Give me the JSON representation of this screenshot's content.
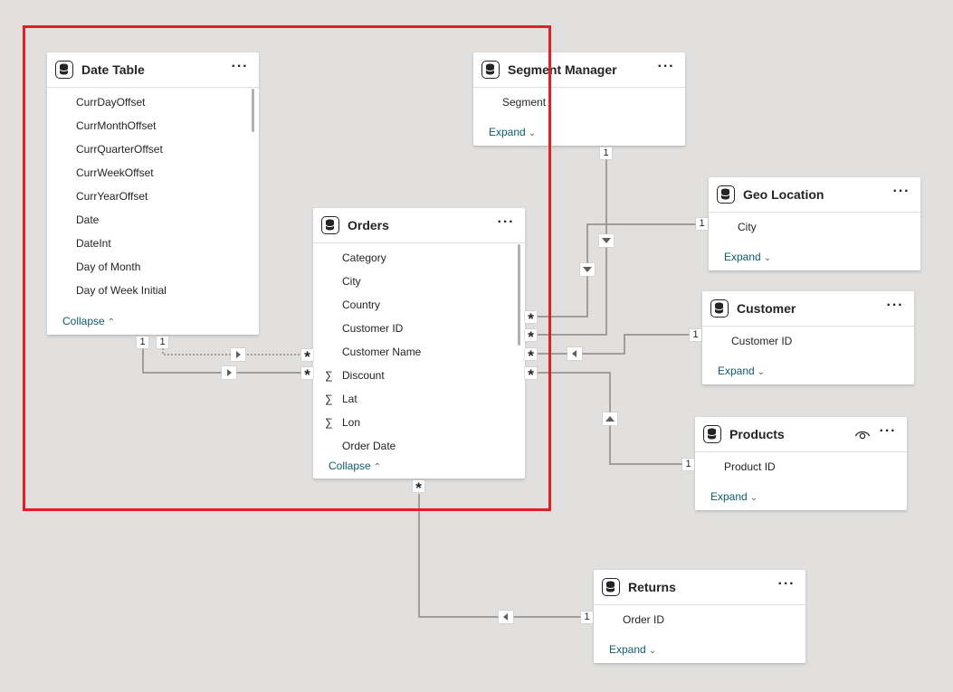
{
  "colors": {
    "canvas": "#e1e0df",
    "card": "#ffffff",
    "selection": "#e11f26",
    "line": "#8a8886",
    "toggle_text": "#0e5c6f"
  },
  "icons": {
    "table": "table-icon",
    "more": "more-options-icon",
    "eye": "eye-icon",
    "sigma": "sum-icon",
    "chevron_up": "chevron-up-icon",
    "chevron_down": "chevron-down-icon"
  },
  "cards": {
    "date_table": {
      "title": "Date Table",
      "more": "···",
      "fields": [
        "CurrDayOffset",
        "CurrMonthOffset",
        "CurrQuarterOffset",
        "CurrWeekOffset",
        "CurrYearOffset",
        "Date",
        "DateInt",
        "Day of Month",
        "Day of Week Initial"
      ],
      "toggle": "Collapse",
      "toggle_chevron": "⌃"
    },
    "segment_manager": {
      "title": "Segment Manager",
      "more": "···",
      "fields": [
        "Segment"
      ],
      "toggle": "Expand",
      "toggle_chevron": "⌄"
    },
    "geo_location": {
      "title": "Geo Location",
      "more": "···",
      "fields": [
        "City"
      ],
      "toggle": "Expand",
      "toggle_chevron": "⌄"
    },
    "orders": {
      "title": "Orders",
      "more": "···",
      "fields": [
        "Category",
        "City",
        "Country",
        "Customer ID",
        "Customer Name",
        "Discount",
        "Lat",
        "Lon",
        "Order Date"
      ],
      "sum_marker": "∑",
      "toggle": "Collapse",
      "toggle_chevron": "⌃"
    },
    "customer": {
      "title": "Customer",
      "more": "···",
      "fields": [
        "Customer ID"
      ],
      "toggle": "Expand",
      "toggle_chevron": "⌄"
    },
    "products": {
      "title": "Products",
      "more": "···",
      "fields": [
        "Product ID"
      ],
      "toggle": "Expand",
      "toggle_chevron": "⌄"
    },
    "returns": {
      "title": "Returns",
      "more": "···",
      "fields": [
        "Order ID"
      ],
      "toggle": "Expand",
      "toggle_chevron": "⌄"
    }
  },
  "relationships": {
    "one": "1",
    "many": "*"
  }
}
